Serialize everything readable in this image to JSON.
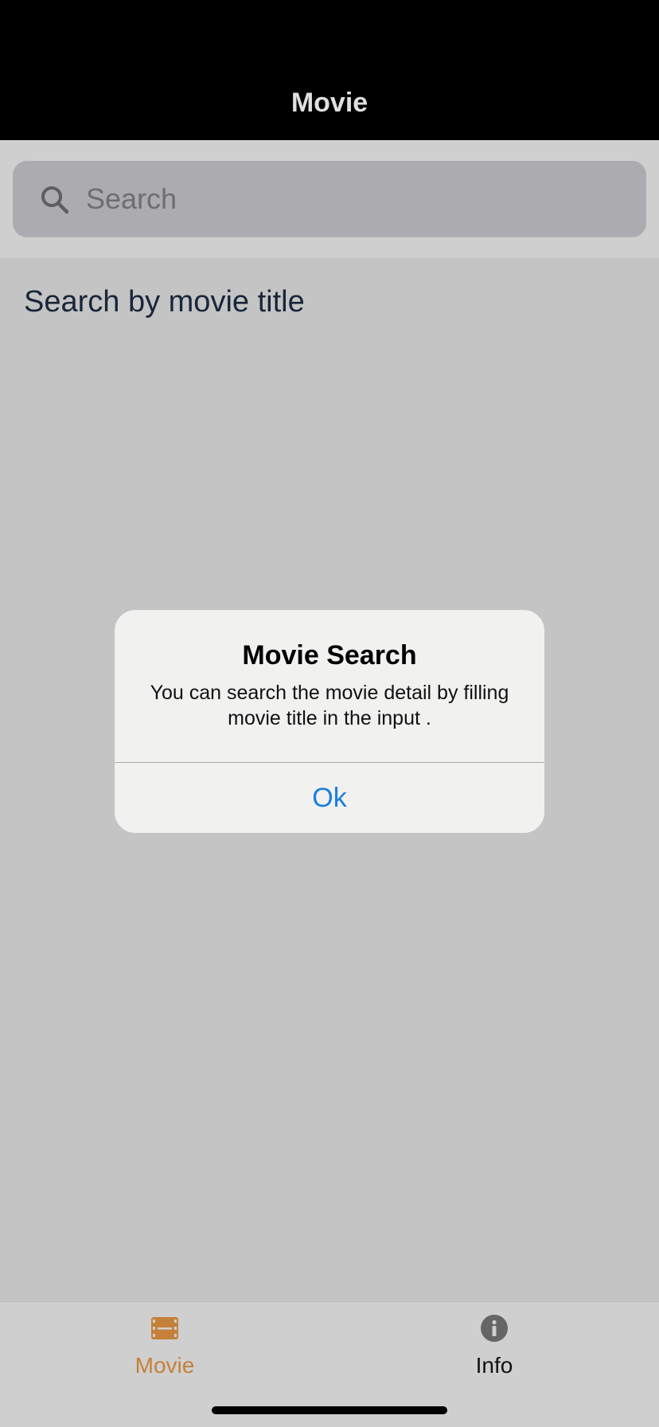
{
  "navbar": {
    "title": "Movie"
  },
  "search": {
    "placeholder": "Search",
    "value": "",
    "icon": "search-icon"
  },
  "content": {
    "section_title": "Search by movie title"
  },
  "dialog": {
    "title": "Movie Search",
    "message": "You can search the movie detail by filling movie title in the input .",
    "button_label": "Ok"
  },
  "tabbar": {
    "items": [
      {
        "label": "Movie",
        "icon": "film-icon",
        "active": true
      },
      {
        "label": "Info",
        "icon": "info-icon",
        "active": false
      }
    ]
  },
  "colors": {
    "accent_active_tab": "#c58039",
    "dialog_button": "#1a7ee0",
    "navbar_bg": "#000000"
  }
}
